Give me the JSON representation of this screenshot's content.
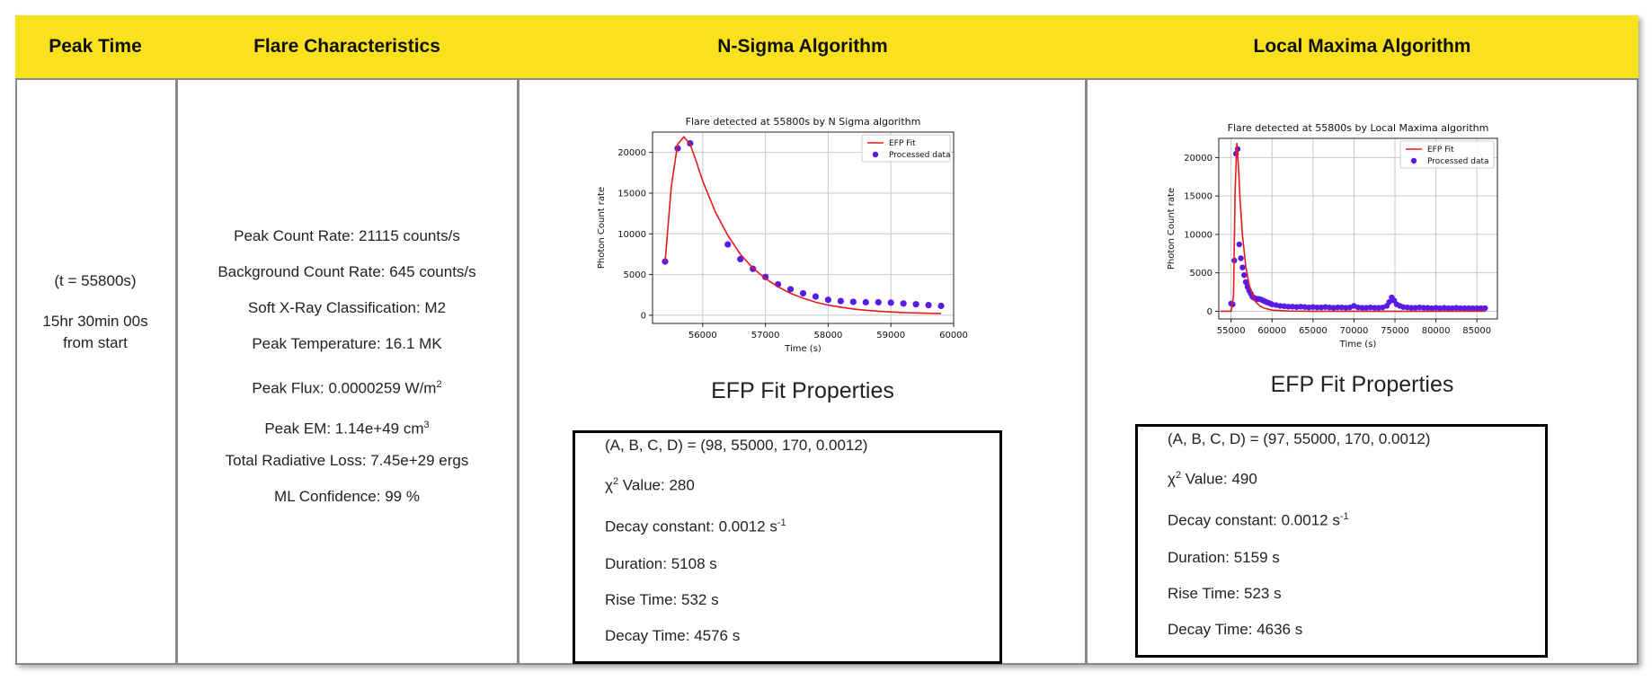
{
  "headers": [
    "Peak Time",
    "Flare Characteristics",
    "N-Sigma Algorithm",
    "Local Maxima Algorithm"
  ],
  "peak_time": {
    "t_label": "(t = 55800s)",
    "elapsed_line1": "15hr 30min 00s",
    "elapsed_line2": "from start"
  },
  "characteristics": {
    "peak_count_rate": "Peak Count Rate: 21115 counts/s",
    "background_count_rate": "Background Count Rate: 645 counts/s",
    "classification": "Soft X-Ray Classification: M2",
    "peak_temperature": "Peak Temperature: 16.1 MK",
    "peak_flux_prefix": "Peak Flux: 0.0000259 W/m",
    "peak_flux_exp": "2",
    "peak_em_prefix": "Peak EM: 1.14e+49 cm",
    "peak_em_exp": "3",
    "radiative_loss": "Total Radiative Loss: 7.45e+29 ergs",
    "ml_confidence": "ML Confidence: 99 %"
  },
  "nsigma": {
    "fit_title": "EFP Fit Properties",
    "params": "(A, B, C, D) = (98, 55000, 170, 0.0012)",
    "chi_symbol": "χ",
    "chi_exp": "2",
    "chi_value": " Value: 280",
    "decay_const_prefix": "Decay constant: 0.0012 s",
    "decay_const_exp": "-1",
    "duration": "Duration: 5108 s",
    "rise_time": "Rise Time: 532 s",
    "decay_time": "Decay Time: 4576 s"
  },
  "localmax": {
    "fit_title": "EFP Fit Properties",
    "params": "(A, B, C, D) = (97, 55000, 170, 0.0012)",
    "chi_symbol": "χ",
    "chi_exp": "2",
    "chi_value": " Value: 490",
    "decay_const_prefix": "Decay constant: 0.0012 s",
    "decay_const_exp": "-1",
    "duration": "Duration: 5159 s",
    "rise_time": "Rise Time: 523 s",
    "decay_time": "Decay Time: 4636 s"
  },
  "colors": {
    "header_bg": "#f9e11d",
    "fit_line": "#e41a1c",
    "data_points": "#5a1ae6"
  },
  "chart_data": [
    {
      "type": "scatter",
      "title": "Flare detected at 55800s by N Sigma algorithm",
      "xlabel": "Time (s)",
      "ylabel": "Photon Count rate",
      "xlim": [
        55200,
        60000
      ],
      "ylim": [
        -1000,
        22500
      ],
      "xticks": [
        56000,
        57000,
        58000,
        59000,
        60000
      ],
      "yticks": [
        0,
        5000,
        10000,
        15000,
        20000
      ],
      "grid": true,
      "legend_position": "top-right",
      "legend": [
        "EFP Fit",
        "Processed data"
      ],
      "series": [
        {
          "name": "Processed data",
          "kind": "points",
          "x": [
            55400,
            55600,
            55800,
            56400,
            56600,
            56800,
            57000,
            57200,
            57400,
            57600,
            57800,
            58000,
            58200,
            58400,
            58600,
            58800,
            59000,
            59200,
            59400,
            59600,
            59800
          ],
          "y": [
            6600,
            20500,
            21115,
            8700,
            6900,
            5700,
            4700,
            3800,
            3200,
            2700,
            2300,
            1900,
            1750,
            1650,
            1600,
            1600,
            1550,
            1450,
            1350,
            1250,
            1150
          ]
        },
        {
          "name": "EFP Fit",
          "kind": "line",
          "x": [
            55400,
            55500,
            55600,
            55700,
            55800,
            55900,
            56000,
            56200,
            56400,
            56600,
            56800,
            57000,
            57200,
            57400,
            57600,
            57800,
            58000,
            58200,
            58400,
            58600,
            58800,
            59000,
            59200,
            59400,
            59600,
            59800
          ],
          "y": [
            6600,
            15800,
            21000,
            21900,
            21000,
            18800,
            16500,
            12700,
            9800,
            7500,
            5800,
            4500,
            3500,
            2700,
            2100,
            1600,
            1250,
            1000,
            780,
            620,
            500,
            410,
            340,
            290,
            250,
            220
          ]
        }
      ]
    },
    {
      "type": "scatter",
      "title": "Flare detected at 55800s by Local Maxima algorithm",
      "xlabel": "Time (s)",
      "ylabel": "Photon Count rate",
      "xlim": [
        53500,
        87500
      ],
      "ylim": [
        -1000,
        22500
      ],
      "xticks": [
        55000,
        60000,
        65000,
        70000,
        75000,
        80000,
        85000
      ],
      "yticks": [
        0,
        5000,
        10000,
        15000,
        20000
      ],
      "grid": true,
      "legend_position": "top-right",
      "legend": [
        "EFP Fit",
        "Processed data"
      ],
      "series": [
        {
          "name": "Processed data",
          "kind": "points",
          "x": [
            55000,
            55200,
            55400,
            55600,
            55800,
            56000,
            56200,
            56400,
            56600,
            56800,
            57000,
            57200,
            57400,
            57600,
            57800,
            58000,
            58200,
            58400,
            58600,
            58800,
            59000,
            59200,
            59400,
            59600,
            59800,
            60000,
            60500,
            61000,
            61500,
            62000,
            62500,
            63000,
            63500,
            64000,
            64500,
            65000,
            65500,
            66000,
            66500,
            67000,
            67500,
            68000,
            68500,
            69000,
            69500,
            70000,
            70500,
            71000,
            71500,
            72000,
            72500,
            73000,
            73500,
            74000,
            74300,
            74600,
            74900,
            75200,
            75600,
            76000,
            76500,
            77000,
            77500,
            78000,
            78500,
            79000,
            79500,
            80000,
            80500,
            81000,
            81500,
            82000,
            82500,
            83000,
            83500,
            84000,
            84500,
            85000,
            85500,
            86000
          ],
          "y": [
            1000,
            900,
            6600,
            20500,
            21115,
            8700,
            6900,
            5700,
            4700,
            3800,
            3200,
            2700,
            2300,
            1900,
            1750,
            1650,
            1600,
            1600,
            1550,
            1450,
            1350,
            1250,
            1150,
            1100,
            1000,
            900,
            800,
            700,
            650,
            600,
            600,
            550,
            600,
            550,
            500,
            550,
            500,
            500,
            550,
            500,
            450,
            500,
            500,
            450,
            500,
            700,
            500,
            450,
            450,
            500,
            450,
            450,
            500,
            700,
            1200,
            1800,
            1400,
            900,
            700,
            550,
            500,
            450,
            450,
            500,
            450,
            450,
            400,
            450,
            400,
            450,
            400,
            400,
            450,
            400,
            400,
            400,
            400,
            400,
            400,
            400
          ]
        },
        {
          "name": "EFP Fit",
          "kind": "line",
          "x": [
            53700,
            55000,
            55300,
            55500,
            55700,
            55900,
            56100,
            56400,
            56800,
            57200,
            57600,
            58000,
            58500,
            59000,
            60000,
            62000,
            65000,
            70000,
            75000,
            80000,
            86000
          ],
          "y": [
            0,
            0,
            2000,
            15800,
            21900,
            18800,
            14500,
            9800,
            5800,
            3500,
            2100,
            1250,
            700,
            410,
            150,
            30,
            0,
            0,
            0,
            0,
            0
          ]
        }
      ]
    }
  ]
}
